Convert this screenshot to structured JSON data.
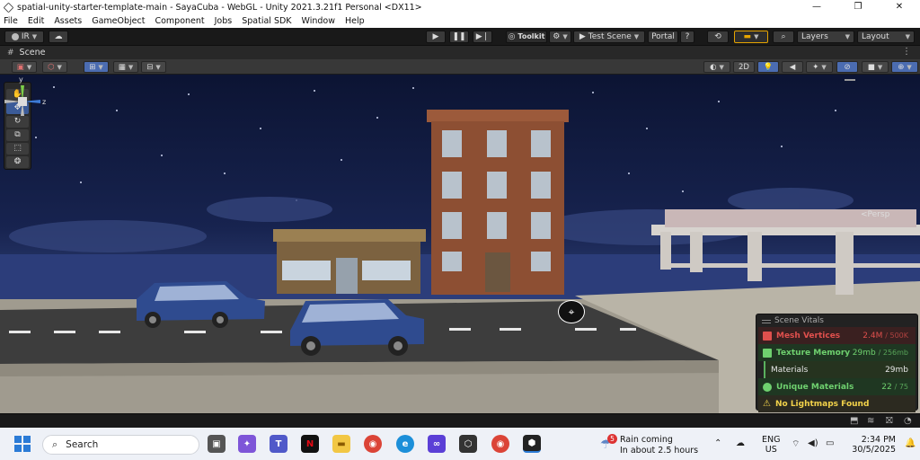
{
  "window": {
    "title": "spatial-unity-starter-template-main - SayaCuba - WebGL - Unity 2021.3.21f1 Personal <DX11>",
    "controls": [
      "—",
      "❐",
      "✕"
    ]
  },
  "menu": [
    "File",
    "Edit",
    "Assets",
    "GameObject",
    "Component",
    "Jobs",
    "Spatial SDK",
    "Window",
    "Help"
  ],
  "toolbar": {
    "account": "IR",
    "toolkit": "Toolkit",
    "test_scene": "Test Scene",
    "portal": "Portal",
    "layers": "Layers",
    "layout": "Layout"
  },
  "scene_tab": {
    "label": "Scene"
  },
  "scene_toolbar": {
    "mode_2d": "2D"
  },
  "viewport": {
    "persp_label": "<Persp",
    "gizmo": {
      "y": "y",
      "z": "z"
    }
  },
  "vitals": {
    "title": "Scene Vitals",
    "rows": [
      {
        "name": "Mesh Vertices",
        "value": "2.4M",
        "limit": "/ 500K",
        "color": "#e0504d"
      },
      {
        "name": "Texture Memory",
        "value": "29mb",
        "limit": "/ 256mb",
        "color": "#6fd16f"
      },
      {
        "name": "Materials",
        "value": "29mb",
        "limit": "",
        "color": "#e6e6e6"
      },
      {
        "name": "Unique Materials",
        "value": "22",
        "limit": "/ 75",
        "color": "#6fd16f"
      },
      {
        "name": "No Lightmaps Found",
        "value": "",
        "limit": "",
        "color": "#f2d24a"
      }
    ]
  },
  "taskbar": {
    "search_placeholder": "Search",
    "weather_badge": "5",
    "weather_line1": "Rain coming",
    "weather_line2": "In about 2.5 hours",
    "lang_line1": "ENG",
    "lang_line2": "US",
    "time": "2:34 PM",
    "date": "30/5/2025"
  },
  "colors": {
    "unity_dark": "#191919",
    "accent_blue": "#3b5b98",
    "vitals_red": "#e0504d",
    "vitals_green": "#6fd16f",
    "vitals_yellow": "#f2d24a"
  }
}
